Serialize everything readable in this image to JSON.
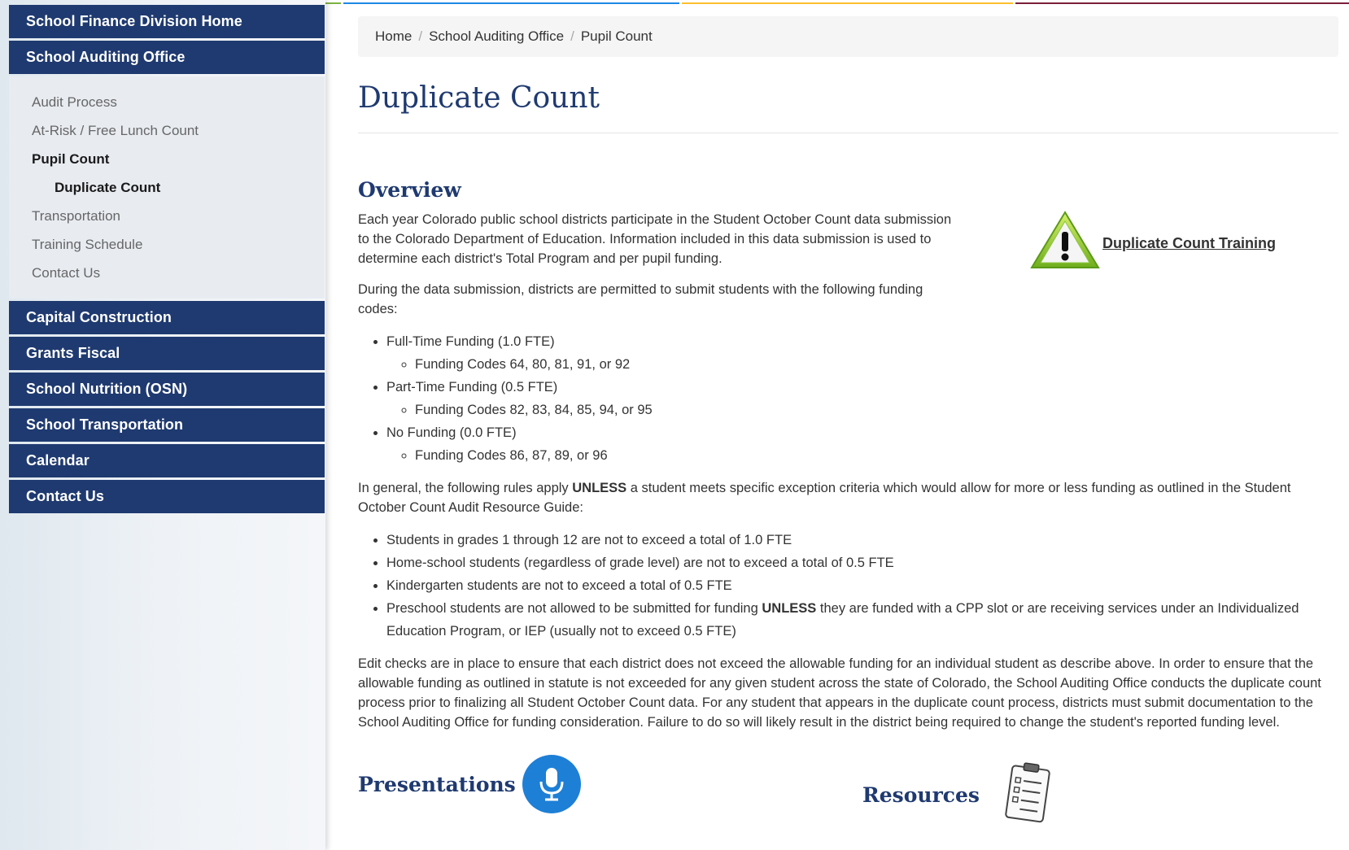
{
  "sidebar": {
    "top_items": [
      {
        "label": "School Finance Division Home"
      },
      {
        "label": "School Auditing Office"
      }
    ],
    "sub_items": [
      {
        "label": "Audit Process"
      },
      {
        "label": "At-Risk / Free Lunch Count"
      },
      {
        "label": "Pupil Count"
      },
      {
        "label": "Duplicate Count"
      },
      {
        "label": "Transportation"
      },
      {
        "label": "Training Schedule"
      },
      {
        "label": "Contact Us"
      }
    ],
    "bottom_items": [
      {
        "label": "Capital Construction"
      },
      {
        "label": "Grants Fiscal"
      },
      {
        "label": "School Nutrition (OSN)"
      },
      {
        "label": "School Transportation"
      },
      {
        "label": "Calendar"
      },
      {
        "label": "Contact Us"
      }
    ]
  },
  "breadcrumb": [
    "Home",
    "School Auditing Office",
    "Pupil Count"
  ],
  "page_title": "Duplicate Count",
  "overview": {
    "heading": "Overview",
    "p1": "Each year Colorado public school districts participate in the Student October Count data submission to the Colorado Department of Education. Information included in this data submission is used to determine each district's Total Program and per pupil funding.",
    "p2": "During the data submission, districts are permitted to submit students with the following funding codes:",
    "funding": [
      {
        "label": "Full-Time Funding (1.0 FTE)",
        "codes": "Funding Codes 64, 80, 81, 91, or 92"
      },
      {
        "label": "Part-Time Funding (0.5 FTE)",
        "codes": "Funding Codes 82, 83, 84, 85, 94, or 95"
      },
      {
        "label": "No Funding (0.0 FTE)",
        "codes": "Funding Codes 86, 87, 89, or 96"
      }
    ],
    "p3_pre": "In general, the following rules apply ",
    "p3_bold": "UNLESS",
    "p3_post": " a student meets specific exception criteria which would allow for more or less funding as outlined in the Student October Count Audit Resource Guide:",
    "rules": [
      "Students in grades 1 through 12 are not to exceed a total of 1.0 FTE",
      "Home-school students (regardless of grade level) are not to exceed a total of 0.5 FTE",
      "Kindergarten students are not to exceed a total of 0.5 FTE"
    ],
    "rule4_pre": "Preschool students are not allowed to be submitted for funding ",
    "rule4_bold": "UNLESS",
    "rule4_post": " they are funded with a CPP slot or are receiving services under an Individualized Education Program, or IEP (usually not to exceed 0.5 FTE)",
    "p4": "Edit checks are in place to ensure that each district does not exceed the allowable funding for an individual student as describe above. In order to ensure that the allowable funding as outlined in statute is not exceeded for any given student across the state of Colorado, the School Auditing Office conducts the duplicate count process prior to finalizing all Student October Count data. For any student that appears in the duplicate count process, districts must submit documentation to the School Auditing Office for funding consideration. Failure to do so will likely result in the district being required to change the student's reported funding level.",
    "training_link": "Duplicate Count Training",
    "training_icon": "warning-triangle-icon"
  },
  "sections": {
    "presentations": "Presentations",
    "presentations_icon": "microphone-icon",
    "resources": "Resources",
    "resources_icon": "clipboard-checklist-icon"
  },
  "colors": {
    "nav_bg": "#1f3a70",
    "heading": "#1f3a70",
    "mic_bg": "#1e7fd6",
    "warning_green": "#9ccc2a"
  }
}
